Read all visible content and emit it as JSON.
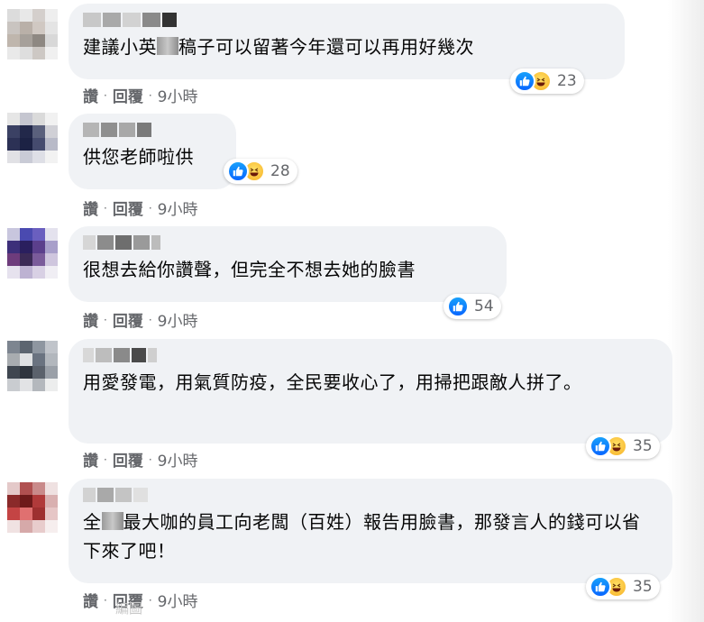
{
  "comments": [
    {
      "text_before": "建議小英",
      "text_after": "稿子可以留著今年還可以再用好幾次",
      "reactions": {
        "types": [
          "like-icon",
          "haha-icon"
        ],
        "count": "23"
      },
      "actions": {
        "like": "讚",
        "reply": "回覆",
        "time": "9小時"
      },
      "avatar_colors": [
        "#dcdcdc",
        "#e8e8e8",
        "#d4cfcc",
        "#eeeeee",
        "#c9c4c0",
        "#b9b0a8",
        "#d0c8c2",
        "#e4e4e4",
        "#bfb6ad",
        "#a6a09a",
        "#8e8882",
        "#d8d8d8",
        "#e9e9e9",
        "#dedede",
        "#cdc8c4",
        "#f0f0f0"
      ]
    },
    {
      "text": "供您老師啦供",
      "reactions": {
        "types": [
          "like-icon",
          "haha-icon"
        ],
        "count": "28"
      },
      "actions": {
        "like": "讚",
        "reply": "回覆",
        "time": "9小時"
      },
      "avatar_colors": [
        "#e6e6e6",
        "#c5c6d0",
        "#dadada",
        "#f1f1f1",
        "#3b4164",
        "#22284a",
        "#5a607c",
        "#d0d0d6",
        "#2c3155",
        "#1c2244",
        "#454b6e",
        "#b8bac8",
        "#e1e1e5",
        "#c9cbd6",
        "#dedfe6",
        "#f2f2f2"
      ]
    },
    {
      "text": "很想去給你讚聲，但完全不想去她的臉書",
      "reactions": {
        "types": [
          "like-icon"
        ],
        "count": "54"
      },
      "actions": {
        "like": "讚",
        "reply": "回覆",
        "time": "9小時"
      },
      "avatar_colors": [
        "#c8c6de",
        "#4a4ab0",
        "#6a5fbf",
        "#e4e2ee",
        "#3d2f7a",
        "#2a1f5e",
        "#5b3f8c",
        "#a89fca",
        "#6e3c7c",
        "#3b2a56",
        "#7a5b9a",
        "#cfc6de",
        "#e6e2ee",
        "#bdb2d2",
        "#d8d0e4",
        "#f0eef4"
      ]
    },
    {
      "text": "用愛發電，用氣質防疫，全民要收心了，用掃把跟敵人拼了。",
      "reactions": {
        "types": [
          "like-icon",
          "haha-icon"
        ],
        "count": "35"
      },
      "actions": {
        "like": "讚",
        "reply": "回覆",
        "time": "9小時"
      },
      "avatar_colors": [
        "#7d8590",
        "#5c6570",
        "#8e96a0",
        "#c0c4ca",
        "#a8acb0",
        "#dfe1e3",
        "#6a7380",
        "#b2b7bd",
        "#3f4650",
        "#2f353e",
        "#5b626c",
        "#9aa0a8",
        "#c9ccd0",
        "#e2e3e5",
        "#b4b8bd",
        "#eceded"
      ]
    },
    {
      "text_before": "全",
      "text_after": "最大咖的員工向老闆（百姓）報告用臉書，那發言人的錢可以省下來了吧！",
      "reactions": {
        "types": [
          "like-icon",
          "haha-icon"
        ],
        "count": "35"
      },
      "actions": {
        "like": "讚",
        "reply": "回覆",
        "time": "9小時"
      },
      "avatar_colors": [
        "#e4c9c9",
        "#b05050",
        "#c98a8a",
        "#efe1e1",
        "#8a2a2a",
        "#6e1a1a",
        "#b03a3a",
        "#d9b0b0",
        "#c44444",
        "#e07070",
        "#9e3030",
        "#e6c6c6",
        "#f0e2e2",
        "#d6a9a9",
        "#e8cccc",
        "#f6eeee"
      ]
    }
  ],
  "watermark": "編圖"
}
